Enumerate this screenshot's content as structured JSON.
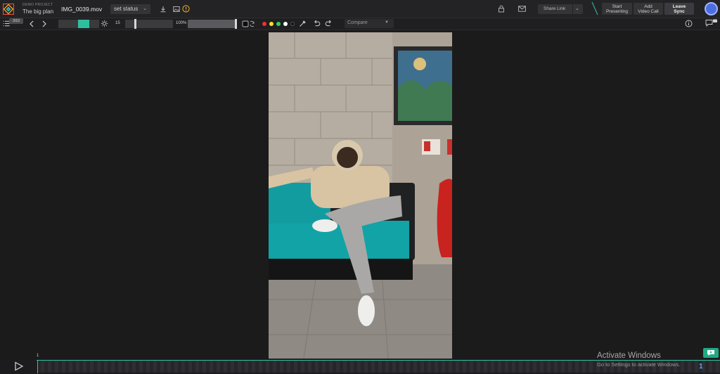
{
  "header": {
    "project_label": "DEMO PROJECT",
    "project_name": "The big plan",
    "file_name": "IMG_0039.mov",
    "status": "set status",
    "share_link": "Share Link",
    "start_presenting": [
      "Start",
      "Presenting"
    ],
    "add_video_call": [
      "Add",
      "Video Call"
    ],
    "leave_sync": [
      "Leave",
      "Sync"
    ]
  },
  "toolbar": {
    "counter": "3/10",
    "frame_rate": "15",
    "zoom": "100%",
    "compare": "Compare",
    "colors": [
      "#ff2d2d",
      "#f5e12a",
      "#2fd15a",
      "#ffffff",
      "#111111"
    ],
    "active_color": "#2fbf9f"
  },
  "timeline": {
    "marker": "1",
    "frame": "1"
  },
  "watermark": {
    "title": "Activate Windows",
    "subtitle": "Go to Settings to activate Windows."
  },
  "icons": [
    "logo-icon",
    "download-icon",
    "image-icon",
    "warning-icon",
    "lock-icon",
    "mail-icon",
    "chevron-down-icon",
    "list-icon",
    "chevron-left-icon",
    "chevron-right-icon",
    "gear-icon",
    "fill-icon",
    "eyedropper-icon",
    "undo-icon",
    "redo-icon",
    "info-icon",
    "comment-icon",
    "play-icon",
    "chat-icon"
  ]
}
